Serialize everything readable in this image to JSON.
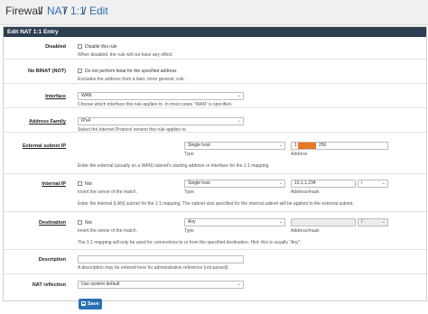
{
  "breadcrumb": {
    "firewall": "Firewall",
    "sep1": "/",
    "nat": "NAT",
    "sep2": "/",
    "one_to_one": "1:1",
    "sep3": "/",
    "edit": "Edit"
  },
  "panel": {
    "title": "Edit NAT 1:1 Entry"
  },
  "disabled": {
    "label": "Disabled",
    "checkbox_text": "Disable this rule",
    "help": "When disabled, the rule will not have any effect."
  },
  "nobinat": {
    "label": "No BINAT (NOT)",
    "checkbox_text": "Do not perform binat for the specified address",
    "help": "Excludes the address from a later, more general, rule."
  },
  "interface": {
    "label": "Interface",
    "value": "WAN",
    "help": "Choose which interface this rule applies to. In most cases \"WAN\" is specified."
  },
  "address_family": {
    "label": "Address Family",
    "value": "IPv4",
    "help": "Select the Internet Protocol version this rule applies to."
  },
  "external_subnet": {
    "label": "External subnet IP",
    "type_value": "Single host",
    "type_caption": "Type",
    "address_prefix": "1",
    "address_suffix": "250",
    "address_caption": "Address",
    "help": "Enter the external (usually on a WAN) subnet's starting address or interface for the 1:1 mapping."
  },
  "internal_ip": {
    "label": "Internal IP",
    "not_text": "Not",
    "invert_help": "Invert the sense of the match.",
    "type_value": "Single host",
    "type_caption": "Type",
    "address_value": "10.1.1.234",
    "mask_sep": "/",
    "address_caption": "Address/mask",
    "help": "Enter the internal (LAN) subnet for the 1:1 mapping. The subnet size specified for the internal subnet will be applied to the external subnet."
  },
  "destination": {
    "label": "Destination",
    "not_text": "Not",
    "invert_help": "Invert the sense of the match.",
    "type_value": "Any",
    "type_caption": "Type",
    "mask_sep": "/",
    "address_caption": "Address/mask",
    "help": "The 1:1 mapping will only be used for connections to or from the specified destination. Hint: this is usually \"Any\"."
  },
  "description": {
    "label": "Description",
    "value": "",
    "help": "A description may be entered here for administrative reference (not parsed)."
  },
  "nat_reflection": {
    "label": "NAT reflection",
    "value": "Use system default"
  },
  "save": {
    "label": "Save"
  },
  "colors": {
    "header": "#2c3e50",
    "link": "#2a6fb3",
    "redaction": "#e87722"
  }
}
